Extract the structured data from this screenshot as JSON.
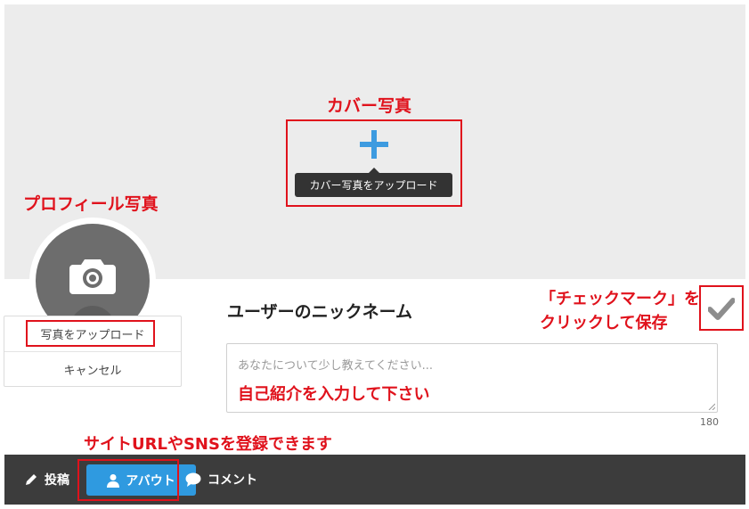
{
  "cover": {
    "annotation": "カバー写真",
    "tooltip": "カバー写真をアップロード"
  },
  "profile": {
    "annotation": "プロフィール写真",
    "menu": {
      "upload": "写真をアップロード",
      "cancel": "キャンセル"
    }
  },
  "nickname": "ユーザーのニックネーム",
  "save": {
    "annotation_line1": "「チェックマーク」を",
    "annotation_line2": "クリックして保存"
  },
  "bio": {
    "placeholder": "あなたについて少し教えてください...",
    "annotation": "自己紹介を入力して下さい",
    "counter": "180"
  },
  "sns_annotation": "サイトURLやSNSを登録できます",
  "nav": {
    "posts": "投稿",
    "about": "アバウト",
    "comments": "コメント"
  },
  "colors": {
    "annotation": "#e0121c",
    "accent": "#2f9ae0",
    "navbar": "#3c3c3c"
  }
}
